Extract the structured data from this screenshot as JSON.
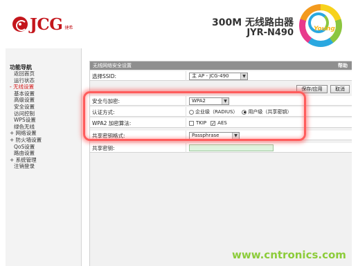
{
  "header": {
    "brand": "JCG",
    "brand_sub": "捷希",
    "product_title": "300M 无线路由器",
    "model": "JYR-N490",
    "badge_text": "Young"
  },
  "sidebar": {
    "title": "功能导航",
    "items": [
      {
        "label": "返回首页",
        "child": true
      },
      {
        "label": "运行状态",
        "child": true
      },
      {
        "label": "- 无线设置",
        "child": false,
        "active": true
      },
      {
        "label": "基本设置",
        "child": true
      },
      {
        "label": "高级设置",
        "child": true
      },
      {
        "label": "安全设置",
        "child": true
      },
      {
        "label": "访问控制",
        "child": true
      },
      {
        "label": "WPS设置",
        "child": true
      },
      {
        "label": "绿色无线",
        "child": true
      },
      {
        "label": "+ 网络设置",
        "child": false
      },
      {
        "label": "+ 防火墙设置",
        "child": false
      },
      {
        "label": "QoS设置",
        "child": true
      },
      {
        "label": "路由设置",
        "child": true
      },
      {
        "label": "+ 系统管理",
        "child": false
      },
      {
        "label": "注销登录",
        "child": true
      }
    ]
  },
  "panel": {
    "title": "无线网络安全设置",
    "help": "帮助",
    "ssid_label": "选择SSID:",
    "ssid_value": "主 AP - JCG-490",
    "save_button": "保存/应用",
    "cancel_button": "取消",
    "security_label": "安全与加密:",
    "security_value": "WPA2",
    "auth_label": "认证方式:",
    "auth_options": [
      "企业级（RADIUS）",
      "用户级（共享密钥）"
    ],
    "auth_selected": 1,
    "algo_label": "WPA2 加密算法:",
    "algo_options": [
      "TKIP",
      "AES"
    ],
    "algo_checked": [
      false,
      true
    ],
    "key_format_label": "共享密钥格式:",
    "key_format_value": "Passphrase",
    "key_label": "共享密钥:",
    "key_value": ""
  },
  "watermark": "www.cntronics.com",
  "colors": {
    "brand_red": "#c4161c",
    "panel_header": "#8f8f8f",
    "highlight": "#ff5c5c",
    "input_green": "#dff4df",
    "watermark_green": "#8ccc3a",
    "nav_active": "#d41a1a"
  }
}
